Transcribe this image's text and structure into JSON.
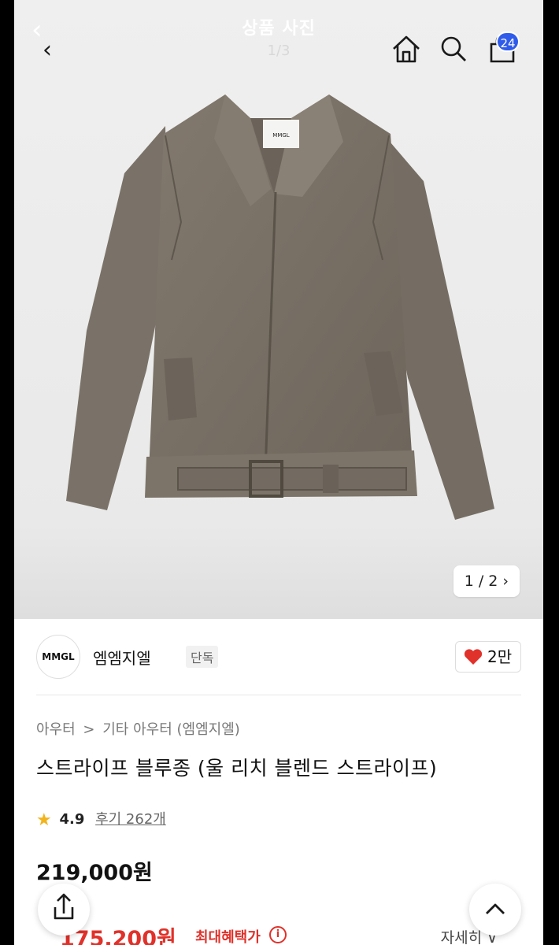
{
  "viewer": {
    "title": "상품 사진",
    "counter": "1/3",
    "cart_count": "24"
  },
  "photo": {
    "pager": "1 / 2 ›",
    "label_text": "MMGL"
  },
  "brand": {
    "logo_text": "MMGL",
    "name": "엠엠지엘",
    "tag": "단독",
    "likes": "2만"
  },
  "breadcrumb": [
    "아우터",
    "기타 아우터 (엠엠지엘)"
  ],
  "product": {
    "title": "스트라이프 블루종 (울 리치 블렌드 스트라이프)",
    "rating": "4.9",
    "review_link": "후기 262개",
    "price": "219,000원",
    "benefit_price": "175,200원",
    "benefit_label": "최대혜택가",
    "detail_link": "자세히 ∨"
  },
  "colors": {
    "accent_red": "#e0312a",
    "badge_blue": "#2f5bea",
    "star": "#f2b41c"
  },
  "icons": [
    "back-icon",
    "home-icon",
    "search-icon",
    "cart-icon",
    "heart-icon",
    "star-icon",
    "info-icon",
    "share-icon",
    "arrow-up-icon",
    "chevron-right-icon"
  ]
}
